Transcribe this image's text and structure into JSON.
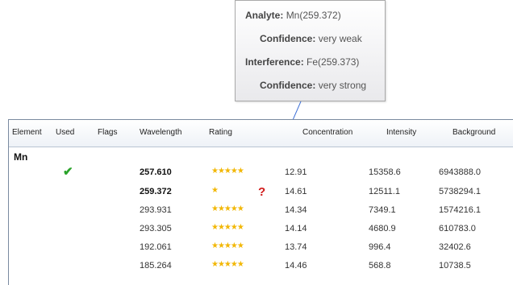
{
  "tooltip": {
    "analyte_label": "Analyte:",
    "analyte_value": "Mn(259.372)",
    "confidence1_label": "Confidence:",
    "confidence1_value": "very weak",
    "interference_label": "Interference:",
    "interference_value": "Fe(259.373)",
    "confidence2_label": "Confidence:",
    "confidence2_value": "very strong"
  },
  "table": {
    "columns": [
      "Element",
      "Used",
      "Flags",
      "Wavelength",
      "Rating",
      "Concentration",
      "Intensity",
      "Background"
    ],
    "group": "Mn",
    "rows": [
      {
        "wavelength": "257.610",
        "rating": 5,
        "rating_text": "★★★★★",
        "concentration": "12.91",
        "intensity": "15358.6",
        "background": "6943888.0",
        "used": true,
        "flag": false,
        "bold": true
      },
      {
        "wavelength": "259.372",
        "rating": 1,
        "rating_text": "★",
        "concentration": "14.61",
        "intensity": "12511.1",
        "background": "5738294.1",
        "used": false,
        "flag": true,
        "bold": true
      },
      {
        "wavelength": "293.931",
        "rating": 5,
        "rating_text": "★★★★★",
        "concentration": "14.34",
        "intensity": "7349.1",
        "background": "1574216.1",
        "used": false,
        "flag": false,
        "bold": false
      },
      {
        "wavelength": "293.305",
        "rating": 5,
        "rating_text": "★★★★★",
        "concentration": "14.14",
        "intensity": "4680.9",
        "background": "610783.0",
        "used": false,
        "flag": false,
        "bold": false
      },
      {
        "wavelength": "192.061",
        "rating": 5,
        "rating_text": "★★★★★",
        "concentration": "13.74",
        "intensity": "996.4",
        "background": "32402.6",
        "used": false,
        "flag": false,
        "bold": false
      },
      {
        "wavelength": "185.264",
        "rating": 5,
        "rating_text": "★★★★★",
        "concentration": "14.46",
        "intensity": "568.8",
        "background": "10738.5",
        "used": false,
        "flag": false,
        "bold": false
      }
    ]
  },
  "icons": {
    "used": "checkmark-icon",
    "flag": "question-mark-icon",
    "rating": "star-icon"
  },
  "colors": {
    "check": "#2aa32a",
    "question": "#d11a1a",
    "star": "#f2b705"
  }
}
